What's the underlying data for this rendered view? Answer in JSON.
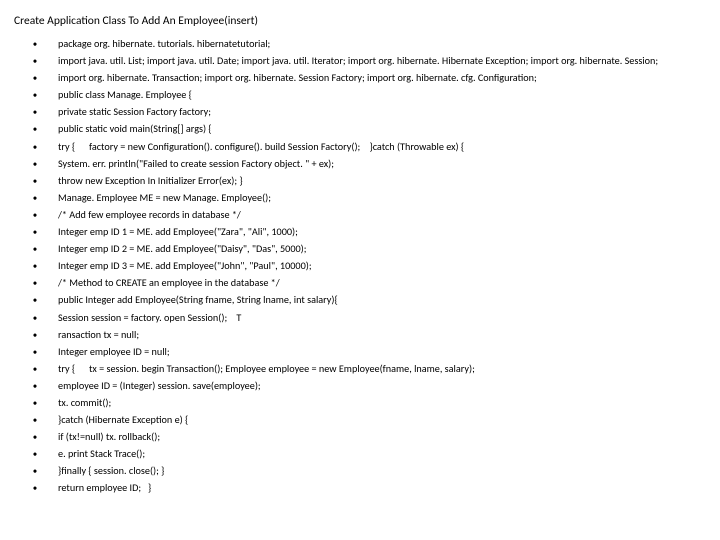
{
  "title": "Create Application Class To Add An Employee(insert)",
  "lines": [
    "package org. hibernate. tutorials. hibernatetutorial;",
    "import java. util. List; import java. util. Date; import java. util. Iterator; import org. hibernate. Hibernate Exception; import org. hibernate. Session;",
    "import org. hibernate. Transaction; import org. hibernate. Session Factory; import org. hibernate. cfg. Configuration;",
    "public class Manage. Employee {",
    "private static Session Factory factory;",
    "public static void main(String[] args) {",
    "try {      factory = new Configuration(). configure(). build Session Factory();    }catch (Throwable ex) {",
    "System. err. println(\"Failed to create session Factory object. \" + ex);",
    "throw new Exception In Initializer Error(ex); }",
    "Manage. Employee ME = new Manage. Employee();",
    "/* Add few employee records in database */",
    "Integer emp ID 1 = ME. add Employee(\"Zara\", \"Ali\", 1000);",
    "Integer emp ID 2 = ME. add Employee(\"Daisy\", \"Das\", 5000);",
    "Integer emp ID 3 = ME. add Employee(\"John\", \"Paul\", 10000);",
    "/* Method to CREATE an employee in the database */",
    "public Integer add Employee(String fname, String lname, int salary){",
    "Session session = factory. open Session();    T",
    "ransaction tx = null;",
    "Integer employee ID = null;",
    "try {      tx = session. begin Transaction(); Employee employee = new Employee(fname, lname, salary);",
    "employee ID = (Integer) session. save(employee);",
    "tx. commit();",
    "}catch (Hibernate Exception e) {",
    "if (tx!=null) tx. rollback();",
    " e. print Stack Trace();",
    "}finally { session. close(); }",
    "return employee ID;   }"
  ]
}
